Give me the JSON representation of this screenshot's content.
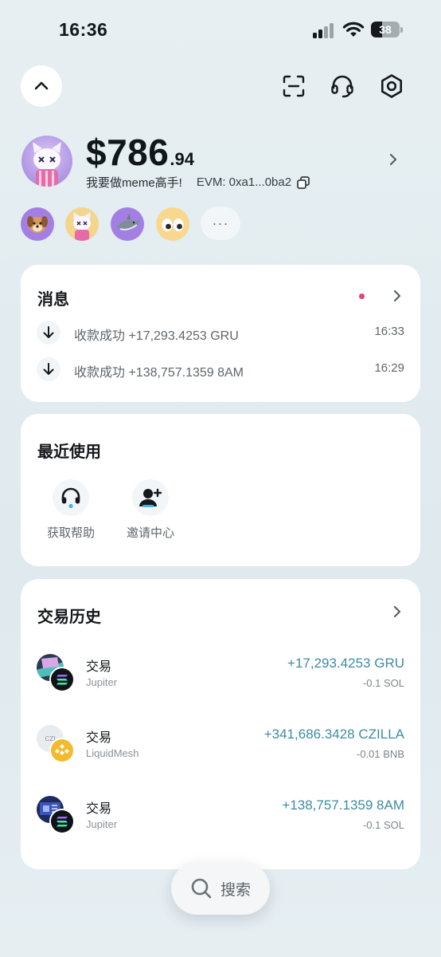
{
  "status_bar": {
    "time": "16:36",
    "battery": "38",
    "battery_level": 0.38
  },
  "wallet": {
    "balance_main": "$786",
    "balance_decimal": ".94",
    "name": "我要做meme高手!",
    "address": "EVM: 0xa1...0ba2"
  },
  "icons": {
    "collapse": "chevron-up-icon",
    "scan": "scan-icon",
    "support": "headset-icon",
    "settings": "settings-icon",
    "more": "more-icon"
  },
  "quick_wallets": {
    "more_label": "···"
  },
  "messages": {
    "title": "消息",
    "items": [
      {
        "text": "收款成功 +17,293.4253 GRU",
        "time": "16:33"
      },
      {
        "text": "收款成功 +138,757.1359 8AM",
        "time": "16:29"
      }
    ]
  },
  "recent": {
    "title": "最近使用",
    "items": [
      {
        "label": "获取帮助",
        "icon": "headset-icon"
      },
      {
        "label": "邀请中心",
        "icon": "add-user-icon"
      }
    ]
  },
  "history": {
    "title": "交易历史",
    "items": [
      {
        "title": "交易",
        "platform": "Jupiter",
        "amount": "+17,293.4253 GRU",
        "fee": "-0.1 SOL"
      },
      {
        "title": "交易",
        "platform": "LiquidMesh",
        "amount": "+341,686.3428 CZILLA",
        "fee": "-0.01 BNB",
        "token_text": "CZI"
      },
      {
        "title": "交易",
        "platform": "Jupiter",
        "amount": "+138,757.1359 8AM",
        "fee": "-0.1 SOL"
      }
    ]
  },
  "search": {
    "label": "搜索"
  },
  "colors": {
    "accent_amount": "#3d8ca3",
    "unread_dot": "#e0456b",
    "support_accent": "#3bb7e8"
  }
}
